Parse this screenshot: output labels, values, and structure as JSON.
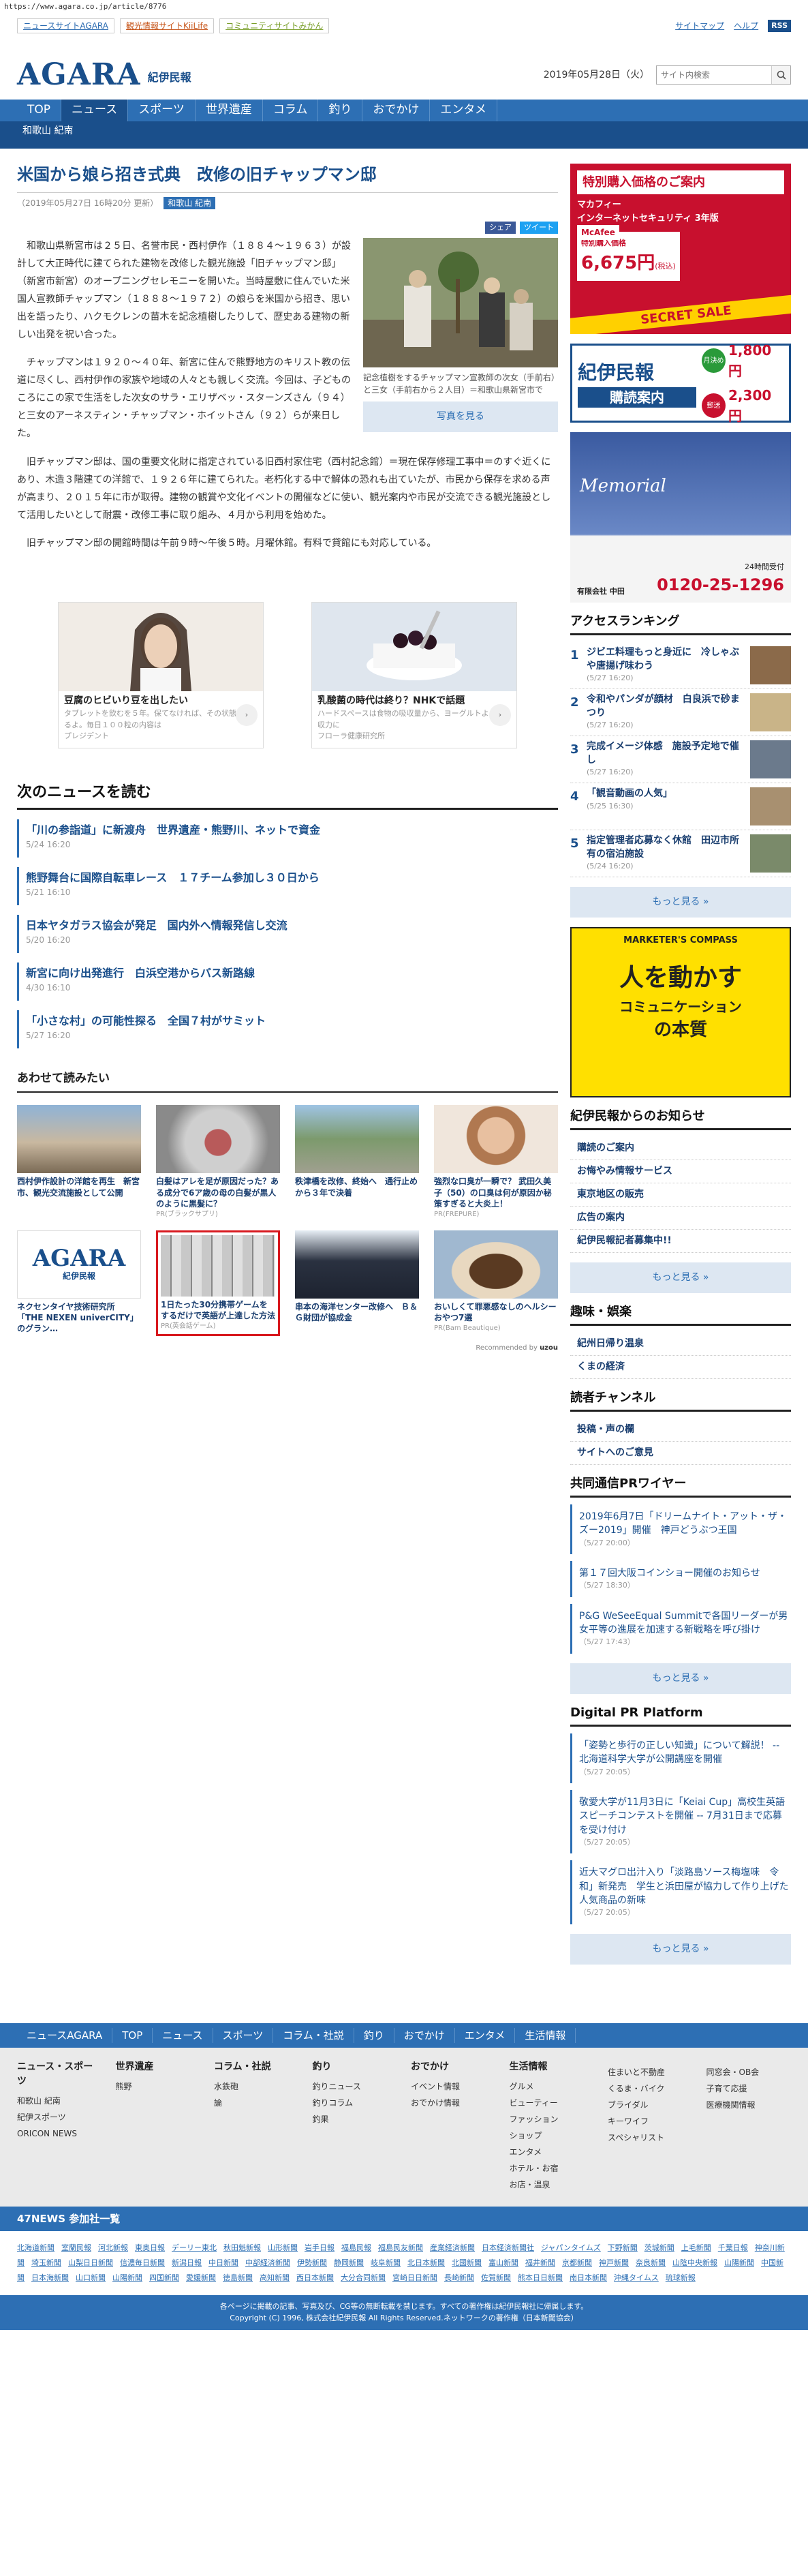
{
  "url": "https://www.agara.co.jp/article/8776",
  "topbar": {
    "links": [
      "ニュースサイトAGARA",
      "観光情報サイトKiiLife",
      "コミュニティサイトみかん"
    ],
    "sitemap": "サイトマップ",
    "help": "ヘルプ",
    "rss": "RSS"
  },
  "header": {
    "logo_en": "AGARA",
    "logo_jp": "紀伊民報",
    "date": "2019年05月28日（火）",
    "search_placeholder": "サイト内検索"
  },
  "nav": [
    "TOP",
    "ニュース",
    "スポーツ",
    "世界遺産",
    "コラム",
    "釣り",
    "おでかけ",
    "エンタメ"
  ],
  "subnav": "和歌山 紀南",
  "article": {
    "title": "米国から娘ら招き式典　改修の旧チャップマン邸",
    "date": "（2019年05月27日 16時20分 更新）",
    "tag": "和歌山 紀南",
    "share_fb": "シェア",
    "share_tw": "ツイート",
    "p1": "和歌山県新宮市は２５日、名誉市民・西村伊作（１８８４～１９６３）が設計して大正時代に建てられた建物を改修した観光施設「旧チャップマン邸」（新宮市新宮）のオープニングセレモニーを開いた。当時屋敷に住んでいた米国人宣教師チャップマン（１８８８～１９７２）の娘らを米国から招き、思い出を語ったり、ハクモクレンの苗木を記念植樹したりして、歴史ある建物の新しい出発を祝い合った。",
    "p2": "チャップマンは１９２０～４０年、新宮に住んで熊野地方のキリスト教の伝道に尽くし、西村伊作の家族や地域の人々とも親しく交流。今回は、子どものころにこの家で生活をした次女のサラ・エリザベッ・スターンズさん（９４）と三女のアーネスティン・チャップマン・ホイットさん（９２）らが来日した。",
    "p3": "旧チャップマン邸は、国の重要文化財に指定されている旧西村家住宅（西村記念館）＝現在保存修理工事中＝のすぐ近くにあり、木造３階建ての洋館で、１９２６年に建てられた。老朽化する中で解体の恐れも出ていたが、市民から保存を求める声が高まり、２０１５年に市が取得。建物の観賞や文化イベントの開催などに使い、観光案内や市民が交流できる観光施設として活用したいとして耐震・改修工事に取り組み、４月から利用を始めた。",
    "p4": "旧チャップマン邸の開館時間は午前９時～午後５時。月曜休館。有料で貸館にも対応している。",
    "caption": "記念植樹をするチャップマン宣教師の次女（手前右）と三女（手前右から２人目）＝和歌山県新宮市で",
    "photo_btn": "写真を見る"
  },
  "ads": [
    {
      "title": "豆腐のヒビいり豆を出したい",
      "sub": "タブレットを飲むを５年。保てなければ、その状態にあるよ。毎日１００粒の内容は",
      "src": "プレジデント"
    },
    {
      "title": "乳酸菌の時代は終り？NHKで話題",
      "sub": "ハードスペースは食物の吸収量から、ヨーグルトより吸収力に",
      "src": "フローラ健康研究所"
    }
  ],
  "next_news": {
    "heading": "次のニュースを読む",
    "items": [
      {
        "t": "「川の参詣道」に新渡舟　世界遺産・熊野川、ネットで資金",
        "d": "5/24 16:20"
      },
      {
        "t": "熊野舞台に国際自転車レース　１７チーム参加し３０日から",
        "d": "5/21 16:10"
      },
      {
        "t": "日本ヤタガラス協会が発足　国内外へ情報発信し交流",
        "d": "5/20 16:20"
      },
      {
        "t": "新宮に向け出発進行　白浜空港からバス新路線",
        "d": "4/30 16:10"
      },
      {
        "t": "「小さな村」の可能性探る　全国７村がサミット",
        "d": "5/27 16:20"
      }
    ]
  },
  "recommend": {
    "heading": "あわせて読みたい",
    "footer": "Recommended by",
    "items": [
      {
        "t": "西村伊作設計の洋館を再生　新宮市、観光交流施設として公開",
        "s": ""
      },
      {
        "t": "白髪はアレを足が原因だった？ある成分で6ア歳の母の白髪が黒人のように黒髪に？",
        "s": "PR(ブラックサプリ)"
      },
      {
        "t": "秩津橋を改修、終始へ　通行止めから３年で決着",
        "s": ""
      },
      {
        "t": "強烈な口臭が一瞬で？ 武田久美子（50）の口臭は何が原因か秘策すぎると大炎上！",
        "s": "PR(FREPURE)"
      },
      {
        "t": "ネクセンタイヤ技術研究所「THE NEXEN univerCITY」のグラン…",
        "s": ""
      },
      {
        "t": "1日たった30分携帯ゲームをするだけで英語が上達した方法",
        "s": "PR(英会話ゲーム)"
      },
      {
        "t": "串本の海洋センター改修へ　Ｂ＆Ｇ財団が協成金",
        "s": ""
      },
      {
        "t": "おいしくて罪悪感なしのヘルシーおやつ7選",
        "s": "PR(Bam Beautique)"
      }
    ]
  },
  "side": {
    "ad1": {
      "top": "特別購入価格のご案内",
      "brand": "McAfee",
      "prod": "マカフィー\nインターネットセキュリティ 3年版",
      "price_label": "特別購入価格",
      "price": "6,675円",
      "tax": "(税込)",
      "sale": "SECRET SALE"
    },
    "ad2": {
      "title": "紀伊民報",
      "sub": "購読案内",
      "p1": "1,800円",
      "p2": "2,300円",
      "l1": "月決め",
      "l2": "郵送"
    },
    "ad3": {
      "brand": "Memorial",
      "tel_label": "24時間受付",
      "tel": "0120-25-1296",
      "company": "有限会社 中田"
    },
    "ranking": {
      "heading": "アクセスランキング",
      "items": [
        {
          "t": "ジビエ料理もっと身近に　冷しゃぶや唐揚げ味わう",
          "d": "(5/27 16:20)"
        },
        {
          "t": "令和やパンダが顔材　白良浜で砂まつり",
          "d": "(5/27 16:20)"
        },
        {
          "t": "完成イメージ体感　施設予定地で催し",
          "d": "(5/27 16:20)"
        },
        {
          "t": "「観音動画の人気」",
          "d": "(5/25 16:30)"
        },
        {
          "t": "指定管理者応募なく休館　田辺市所有の宿泊施設",
          "d": "(5/24 16:20)"
        }
      ]
    },
    "more": "もっと見る »",
    "ad4": {
      "top": "MARKETER'S COMPASS",
      "line1": "人を動かす",
      "line2": "コミュニケーション",
      "line3": "の本質"
    },
    "notice": {
      "heading": "紀伊民報からのお知らせ",
      "items": [
        "購読のご案内",
        "お悔やみ情報サービス",
        "東京地区の販売",
        "広告の案内",
        "紀伊民報記者募集中!!"
      ]
    },
    "hobby": {
      "heading": "趣味・娯楽",
      "items": [
        "紀州日帰り温泉",
        "くまの経済"
      ]
    },
    "reader": {
      "heading": "読者チャンネル",
      "items": [
        "投稿・声の欄",
        "サイトへのご意見"
      ]
    },
    "kyodo": {
      "heading": "共同通信PRワイヤー",
      "items": [
        {
          "t": "2019年6月7日「ドリームナイト・アット・ザ・ズー2019」開催　神戸どうぶつ王国",
          "d": "（5/27 20:00）"
        },
        {
          "t": "第１７回大阪コインショー開催のお知らせ",
          "d": "（5/27 18:30）"
        },
        {
          "t": "P&G WeSeeEqual Summitで各国リーダーが男女平等の進展を加速する新戦略を呼び掛け",
          "d": "（5/27 17:43）"
        }
      ]
    },
    "digital": {
      "heading": "Digital PR Platform",
      "items": [
        {
          "t": "「姿勢と歩行の正しい知識」について解説！ -- 北海道科学大学が公開講座を開催",
          "d": "（5/27 20:05）"
        },
        {
          "t": "敬愛大学が11月3日に「Keiai Cup」高校生英語スピーチコンテストを開催 -- 7月31日まで応募を受け付け",
          "d": "（5/27 20:05）"
        },
        {
          "t": "近大マグロ出汁入り「淡路島ソース梅塩味　令和」新発売　学生と浜田屋が協力して作り上げた人気商品の新味",
          "d": "（5/27 20:05）"
        }
      ]
    }
  },
  "footer": {
    "nav": [
      "ニュースAGARA",
      "TOP",
      "ニュース",
      "スポーツ",
      "コラム・社説",
      "釣り",
      "おでかけ",
      "エンタメ",
      "生活情報"
    ],
    "cols": [
      {
        "h": "ニュース・スポーツ",
        "x": [
          "和歌山 紀南",
          "紀伊スポーツ",
          "ORICON NEWS"
        ]
      },
      {
        "h": "世界遺産",
        "x": [
          "熊野"
        ]
      },
      {
        "h": "コラム・社説",
        "x": [
          "水鉄砲",
          "論"
        ]
      },
      {
        "h": "釣り",
        "x": [
          "釣りニュース",
          "釣りコラム",
          "釣果"
        ]
      },
      {
        "h": "おでかけ",
        "x": [
          "イベント情報",
          "おでかけ情報"
        ]
      },
      {
        "h": "生活情報",
        "x": [
          "グルメ",
          "ビューティー",
          "ファッション",
          "ショップ",
          "エンタメ",
          "ホテル・お宿",
          "お店・温泉"
        ]
      },
      {
        "h": " ",
        "x": [
          "住まいと不動産",
          "くるま・バイク",
          "ブライダル",
          "キーワイフ",
          "スペシャリスト"
        ]
      },
      {
        "h": " ",
        "x": [
          "同窓会・OB会",
          "子育て応援",
          "医療機関情報"
        ]
      }
    ],
    "news47": "47NEWS 参加社一覧",
    "papers": [
      "北海道新聞",
      "室蘭民報",
      "河北新報",
      "東奥日報",
      "デーリー東北",
      "秋田魁新報",
      "山形新聞",
      "岩手日報",
      "福島民報",
      "福島民友新聞",
      "産業経済新聞",
      "日本経済新聞社",
      "ジャパンタイムズ",
      "下野新聞",
      "茨城新聞",
      "上毛新聞",
      "千葉日報",
      "神奈川新聞",
      "埼玉新聞",
      "山梨日日新聞",
      "信濃毎日新聞",
      "新潟日報",
      "中日新聞",
      "中部経済新聞",
      "伊勢新聞",
      "静岡新聞",
      "岐阜新聞",
      "北日本新聞",
      "北國新聞",
      "富山新聞",
      "福井新聞",
      "京都新聞",
      "神戸新聞",
      "奈良新聞",
      "山陰中央新報",
      "山陽新聞",
      "中国新聞",
      "日本海新聞",
      "山口新聞",
      "山陽新聞",
      "四国新聞",
      "愛媛新聞",
      "徳島新聞",
      "高知新聞",
      "西日本新聞",
      "大分合同新聞",
      "宮崎日日新聞",
      "長崎新聞",
      "佐賀新聞",
      "熊本日日新聞",
      "南日本新聞",
      "沖縄タイムス",
      "琉球新報"
    ],
    "copy1": "各ページに掲載の記事、写真及び、CG等の無断転載を禁じます。すべての著作権は紀伊民報社に帰属します。",
    "copy2": "Copyright (C) 1996, 株式会社紀伊民報 All Rights Reserved.ネットワークの著作権（日本新聞協会）"
  }
}
